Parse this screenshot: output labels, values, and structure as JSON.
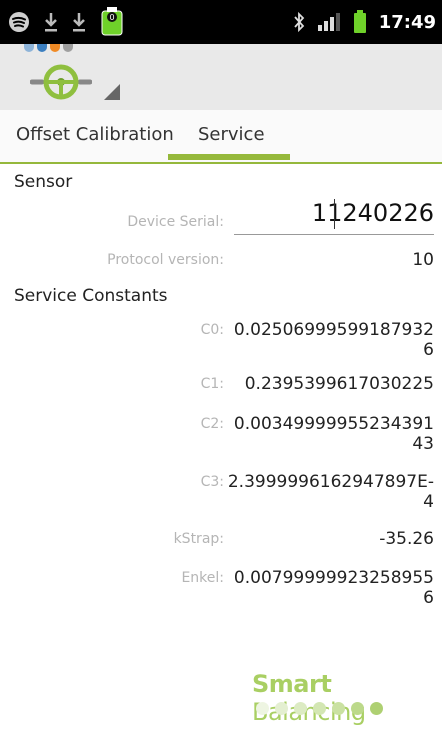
{
  "status_bar": {
    "time": "17:49",
    "icons": [
      "spotify-icon",
      "download-icon",
      "download-icon",
      "battery-alert-icon",
      "bluetooth-icon",
      "signal-icon",
      "battery-icon"
    ]
  },
  "action_bar": {
    "app_icon": "steering-wheel-icon",
    "dot_colors": [
      "#8db3d8",
      "#3c7fc0",
      "#f08a25",
      "#9f9f9f"
    ]
  },
  "tabs": [
    {
      "label": "Offset Calibration",
      "selected": false
    },
    {
      "label": "Service",
      "selected": true
    }
  ],
  "accent": "#95b83b",
  "sensor": {
    "title": "Sensor",
    "device_serial_label": "Device Serial:",
    "device_serial_value": "11240226",
    "protocol_label": "Protocol version:",
    "protocol_value": "10"
  },
  "constants": {
    "title": "Service Constants",
    "c0": {
      "label": "C0:",
      "line1": "0.02506999599187932",
      "line2": "6"
    },
    "c1": {
      "label": "C1:",
      "value": "0.2395399617030225"
    },
    "c2": {
      "label": "C2:",
      "line1": "0.00349999955234391",
      "line2": "43"
    },
    "c3": {
      "label": "C3:",
      "line1": "2.3999996162947897E-",
      "line2": "4"
    },
    "kstrap": {
      "label": "kStrap:",
      "value": "-35.26"
    },
    "enkel": {
      "label": "Enkel:",
      "line1": "0.00799999923258955",
      "line2": "6"
    }
  },
  "brand": {
    "bold": "Smart",
    "rest": " Balancing"
  }
}
